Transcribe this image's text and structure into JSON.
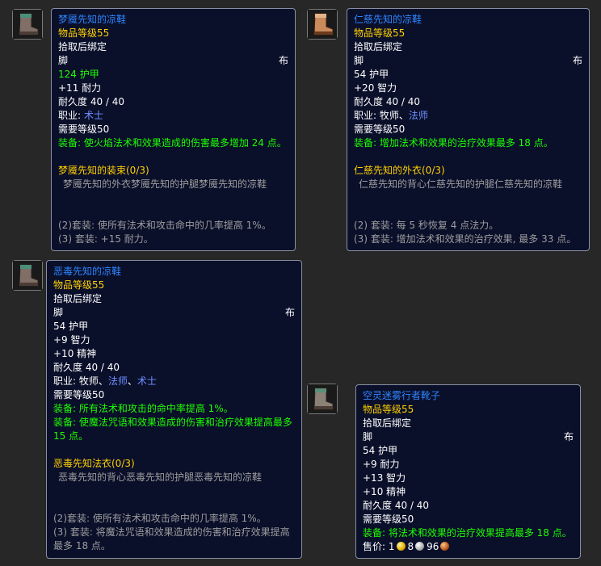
{
  "tooltips": [
    {
      "icon": "boots-icon",
      "name": "梦魇先知的凉鞋",
      "item_level": "物品等级55",
      "bind": "拾取后绑定",
      "slot": "脚",
      "type": "布",
      "stats": [
        {
          "text": "124 护甲",
          "color": "green"
        },
        {
          "text": "+11 耐力",
          "color": "white"
        }
      ],
      "durability": "耐久度 40 / 40",
      "class_prefix": "职业: ",
      "classes": [
        {
          "text": "术士",
          "color": "cls"
        }
      ],
      "req_level": "需要等级50",
      "equip": [
        "装备: 使火焰法术和效果造成的伤害最多增加 24 点。"
      ],
      "set_name": "梦魇先知的装束(0/3)",
      "set_pieces": "梦魇先知的外衣梦魇先知的护腿梦魇先知的凉鞋",
      "set_bonuses": [
        "(2)套装: 使所有法术和攻击命中的几率提高 1%。",
        "(3) 套装: +15 耐力。"
      ]
    },
    {
      "icon": "boots-icon",
      "name": "仁慈先知的凉鞋",
      "item_level": "物品等级55",
      "bind": "拾取后绑定",
      "slot": "脚",
      "type": "布",
      "stats": [
        {
          "text": "54 护甲",
          "color": "white"
        },
        {
          "text": "+20 智力",
          "color": "white"
        }
      ],
      "durability": "耐久度 40 / 40",
      "class_prefix": "职业: ",
      "classes": [
        {
          "text": "牧师",
          "color": "white"
        },
        {
          "text": "、",
          "color": "white"
        },
        {
          "text": "法师",
          "color": "cls"
        }
      ],
      "req_level": "需要等级50",
      "equip": [
        "装备: 增加法术和效果的治疗效果最多 18 点。"
      ],
      "set_name": "仁慈先知的外衣(0/3)",
      "set_pieces": "仁慈先知的背心仁慈先知的护腿仁慈先知的凉鞋",
      "set_bonuses": [
        "(2) 套装: 每 5 秒恢复 4 点法力。",
        "(3) 套装: 增加法术和效果的治疗效果, 最多 33 点。"
      ]
    },
    {
      "icon": "boots-icon",
      "name": "恶毒先知的凉鞋",
      "item_level": "物品等级55",
      "bind": "拾取后绑定",
      "slot": "脚",
      "type": "布",
      "stats": [
        {
          "text": "54 护甲",
          "color": "white"
        },
        {
          "text": "+9 智力",
          "color": "white"
        },
        {
          "text": "+10 精神",
          "color": "white"
        }
      ],
      "durability": "耐久度 40 / 40",
      "class_prefix": "职业: ",
      "classes": [
        {
          "text": "牧师",
          "color": "white"
        },
        {
          "text": "、",
          "color": "white"
        },
        {
          "text": "法师",
          "color": "cls"
        },
        {
          "text": "、",
          "color": "white"
        },
        {
          "text": "术士",
          "color": "cls"
        }
      ],
      "req_level": "需要等级50",
      "equip": [
        "装备: 所有法术和攻击的命中率提高 1%。",
        "装备: 使魔法咒语和效果造成的伤害和治疗效果提高最多 15 点。"
      ],
      "set_name": "恶毒先知法衣(0/3)",
      "set_pieces": "恶毒先知的背心恶毒先知的护腿恶毒先知的凉鞋",
      "set_bonuses": [
        "(2)套装: 使所有法术和攻击命中的几率提高 1%。",
        "(3) 套装: 将魔法咒语和效果造成的伤害和治疗效果提高最多 18 点。"
      ]
    },
    {
      "icon": "boots-icon",
      "name": "空灵迷雾行者靴子",
      "item_level": "物品等级55",
      "bind": "拾取后绑定",
      "slot": "脚",
      "type": "布",
      "stats": [
        {
          "text": "54 护甲",
          "color": "white"
        },
        {
          "text": "+9 耐力",
          "color": "white"
        },
        {
          "text": "+13 智力",
          "color": "white"
        },
        {
          "text": "+10 精神",
          "color": "white"
        }
      ],
      "durability": "耐久度 40 / 40",
      "req_level": "需要等级50",
      "equip": [
        "装备: 将法术和效果的治疗效果提高最多 18 点。"
      ],
      "sell": {
        "label": "售价: ",
        "gold": "1",
        "silver": "8",
        "copper": "96"
      }
    }
  ]
}
